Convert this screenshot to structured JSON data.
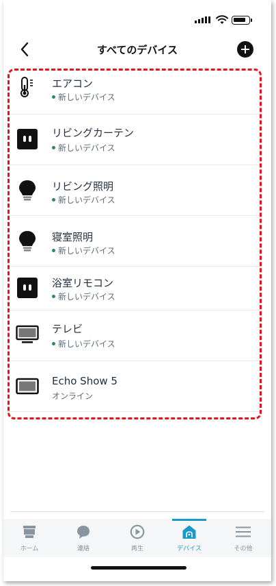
{
  "header": {
    "title": "すべてのデバイス",
    "back_icon": "chevron-left-icon",
    "add_icon": "plus-circle-icon"
  },
  "devices": [
    {
      "name": "エアコン",
      "status": "新しいデバイス",
      "icon": "thermometer-icon",
      "new": true
    },
    {
      "name": "リビングカーテン",
      "status": "新しいデバイス",
      "icon": "smart-plug-icon",
      "new": true
    },
    {
      "name": "リビング照明",
      "status": "新しいデバイス",
      "icon": "light-bulb-icon",
      "new": true
    },
    {
      "name": "寝室照明",
      "status": "新しいデバイス",
      "icon": "light-bulb-icon",
      "new": true
    },
    {
      "name": "浴室リモコン",
      "status": "新しいデバイス",
      "icon": "smart-plug-icon",
      "new": true
    },
    {
      "name": "テレビ",
      "status": "新しいデバイス",
      "icon": "tv-icon",
      "new": true
    },
    {
      "name": "Echo Show 5",
      "status": "オンライン",
      "icon": "echo-show-icon",
      "new": false
    }
  ],
  "tabs": [
    {
      "label": "ホーム",
      "icon": "home-icon",
      "active": false
    },
    {
      "label": "連絡",
      "icon": "chat-bubble-icon",
      "active": false
    },
    {
      "label": "再生",
      "icon": "play-icon",
      "active": false
    },
    {
      "label": "デバイス",
      "icon": "devices-house-icon",
      "active": true
    },
    {
      "label": "その他",
      "icon": "menu-icon",
      "active": false
    }
  ],
  "colors": {
    "accent": "#1a98c7",
    "highlight": "#e8141b",
    "status_dot": "#2e8b57",
    "text_primary": "#232f3e",
    "text_secondary": "#5e6b78"
  }
}
